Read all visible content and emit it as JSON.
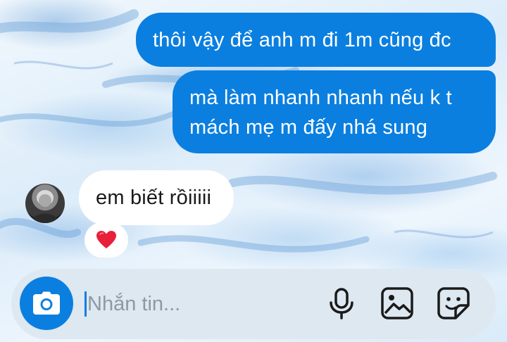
{
  "conversation": {
    "messages": [
      {
        "direction": "outgoing",
        "text": "thôi vậy để anh m đi 1m cũng đc"
      },
      {
        "direction": "outgoing",
        "line1": "mà làm nhanh nhanh nếu k t",
        "line2": "mách mẹ m đấy nhá sung"
      },
      {
        "direction": "incoming",
        "text": "em biết rồiiiii",
        "reaction": "❤️"
      }
    ]
  },
  "composer": {
    "placeholder": "Nhắn tin...",
    "value": "",
    "icons": [
      "camera-icon",
      "microphone-icon",
      "image-icon",
      "sticker-icon"
    ]
  },
  "colors": {
    "accent": "#0a7fe0",
    "incoming_bubble": "#ffffff",
    "composer_bg": "#dde8f1",
    "heart": "#e8203a"
  }
}
